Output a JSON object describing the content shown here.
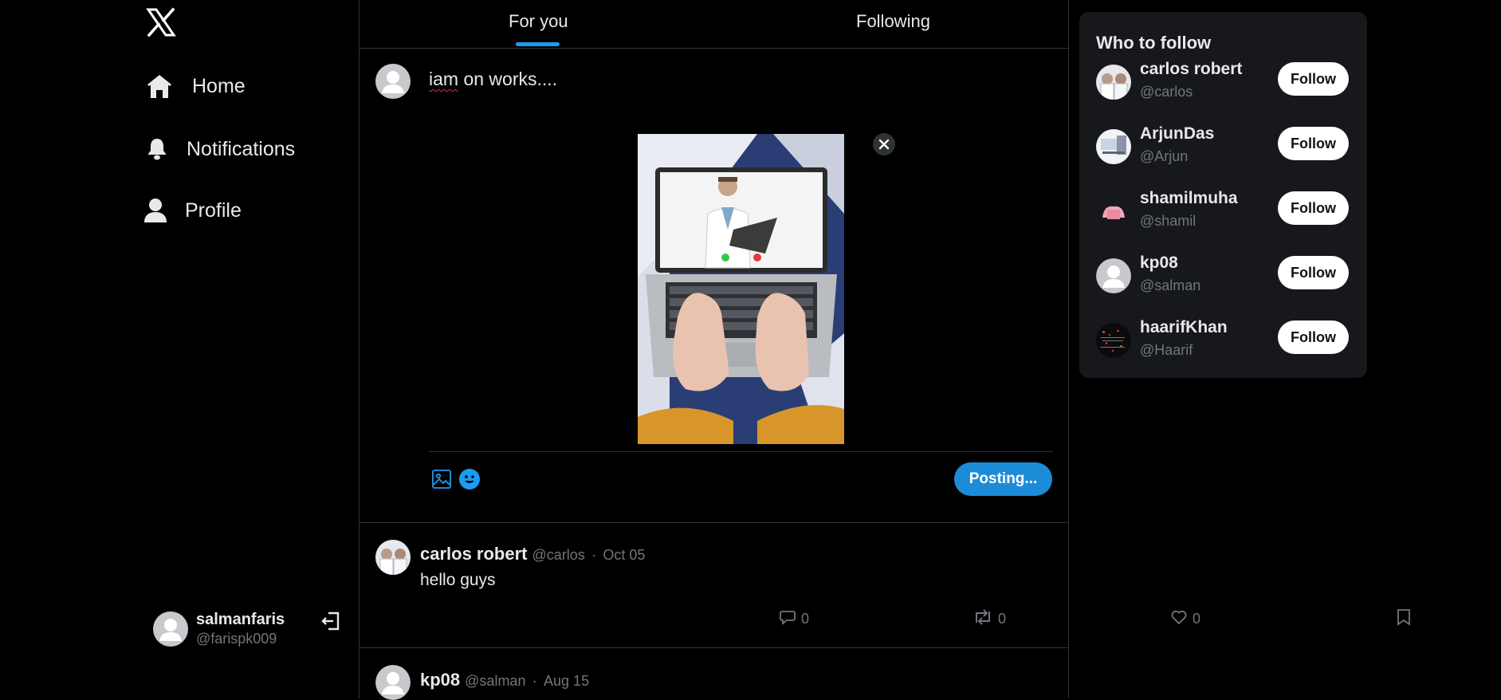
{
  "sidebar": {
    "logo_icon": "x-logo-icon",
    "nav": [
      {
        "label": "Home",
        "icon": "home-icon"
      },
      {
        "label": "Notifications",
        "icon": "bell-icon"
      },
      {
        "label": "Profile",
        "icon": "user-icon"
      }
    ],
    "account": {
      "display_name": "salmanfaris",
      "handle": "@farispk009",
      "logout_icon": "logout-icon"
    }
  },
  "tabs": [
    {
      "label": "For you",
      "active": true
    },
    {
      "label": "Following",
      "active": false
    }
  ],
  "composer": {
    "text_underlined": "iam",
    "text_rest": " on works....",
    "media_icon": "image-icon",
    "emoji_icon": "emoji-icon",
    "post_button": "Posting..."
  },
  "posts": [
    {
      "name": "carlos robert",
      "handle": "@carlos",
      "date": "Oct 05",
      "separator": "·",
      "text": "hello guys",
      "replies": "0",
      "reposts": "0",
      "likes": "0"
    },
    {
      "name": "kp08",
      "handle": "@salman",
      "date": "Aug 15",
      "separator": "·"
    }
  ],
  "who_to_follow": {
    "title": "Who to follow",
    "button_label": "Follow",
    "users": [
      {
        "name": "carlos robert",
        "handle": "@carlos"
      },
      {
        "name": "ArjunDas",
        "handle": "@Arjun"
      },
      {
        "name": "shamilmuha",
        "handle": "@shamil"
      },
      {
        "name": "kp08",
        "handle": "@salman"
      },
      {
        "name": "haarifKhan",
        "handle": "@Haarif"
      }
    ]
  },
  "colors": {
    "background": "#000000",
    "accent": "#1d9bf0",
    "muted": "#71767b",
    "panel": "#16181c",
    "border": "#2f3336"
  }
}
